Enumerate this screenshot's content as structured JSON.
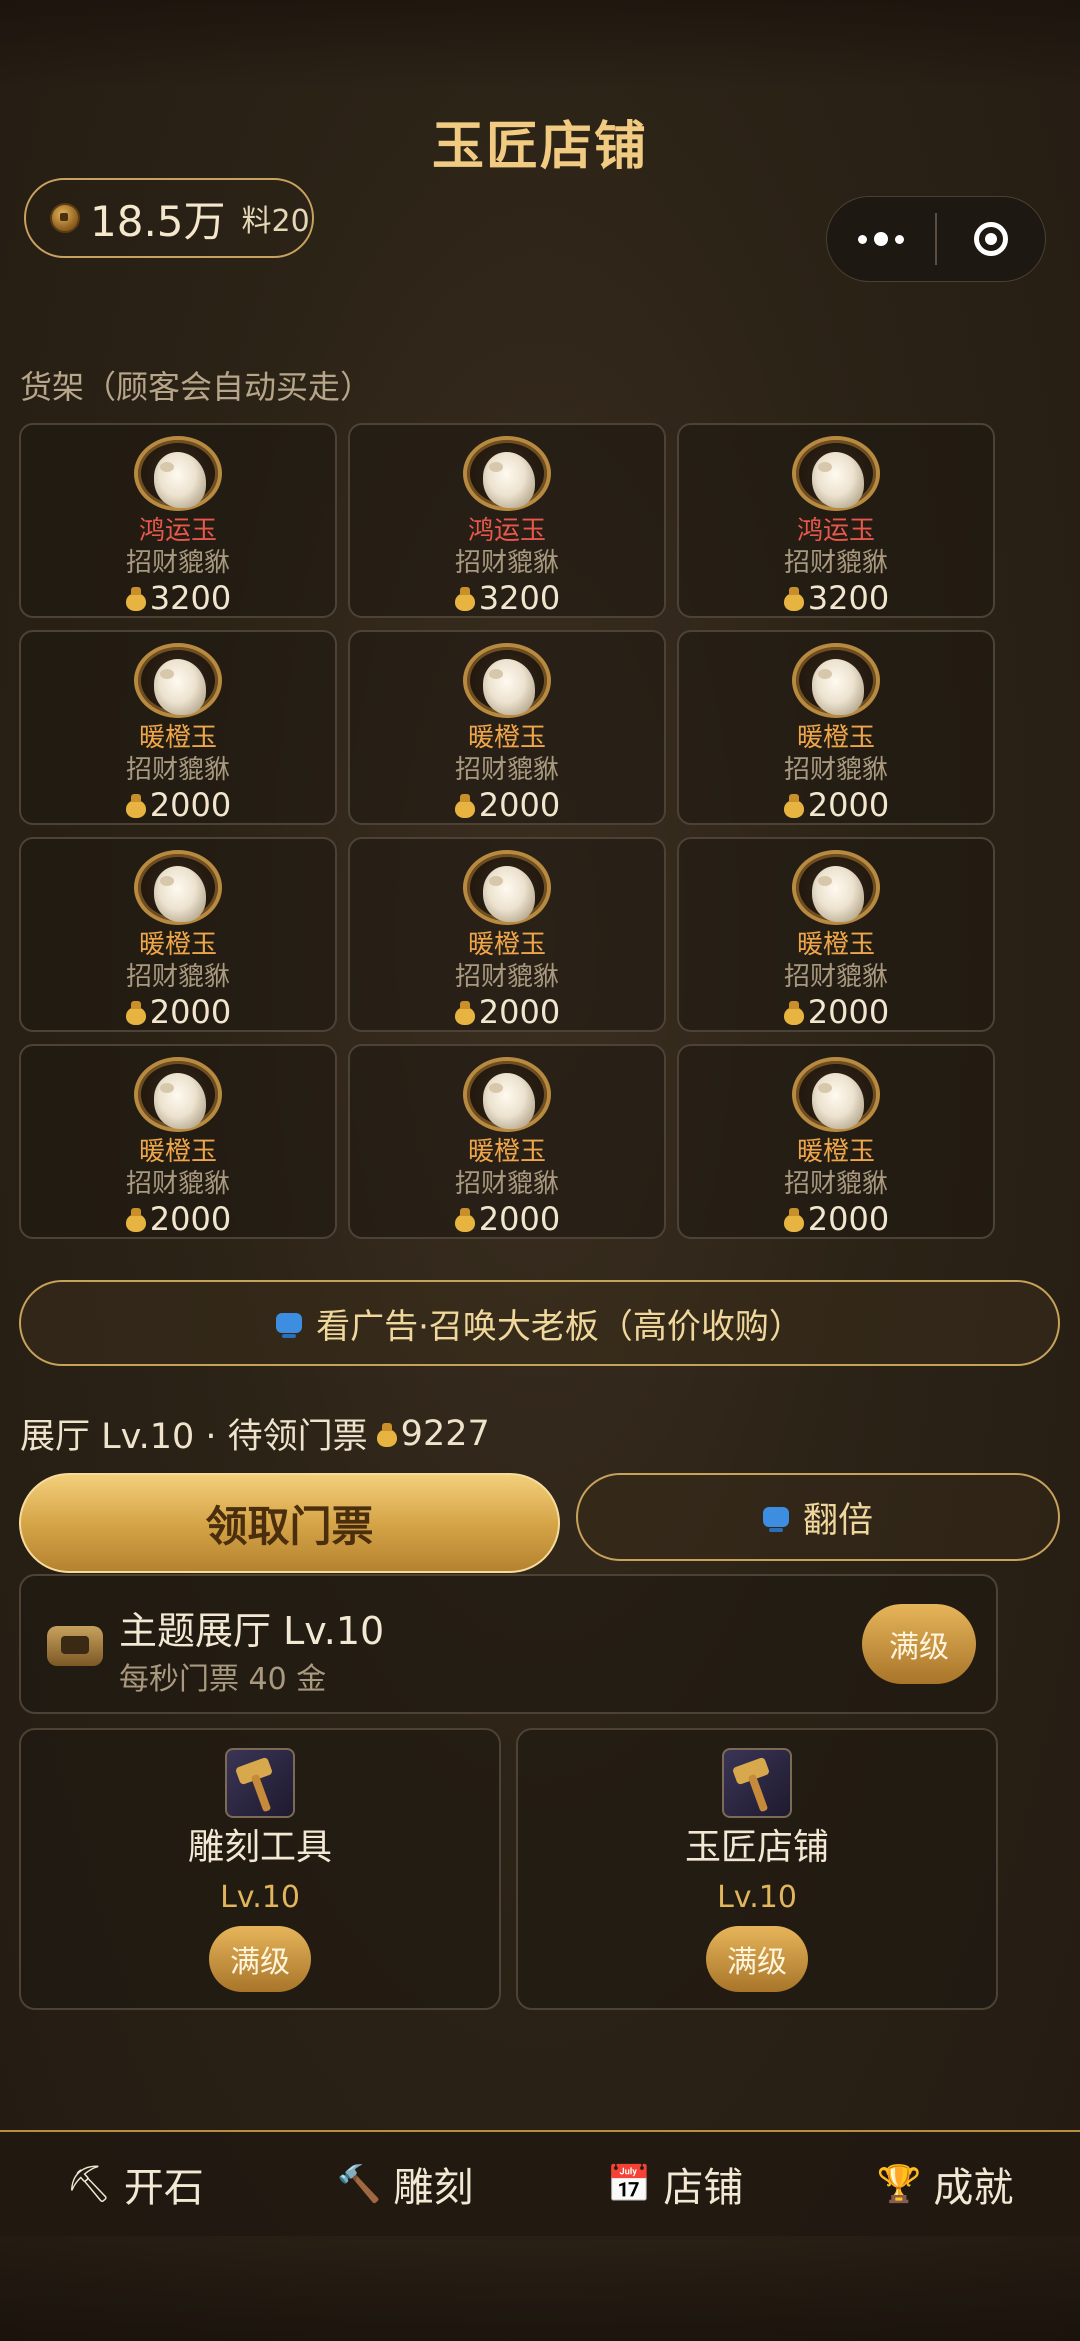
{
  "header": {
    "title": "玉匠店铺"
  },
  "wallet": {
    "amount": "18.5万",
    "material": "料20"
  },
  "shelf": {
    "label": "货架（顾客会自动买走）",
    "items": [
      {
        "grade": "鸿运玉",
        "grade_color": "red",
        "name": "招财貔貅",
        "price": "3200"
      },
      {
        "grade": "鸿运玉",
        "grade_color": "red",
        "name": "招财貔貅",
        "price": "3200"
      },
      {
        "grade": "鸿运玉",
        "grade_color": "red",
        "name": "招财貔貅",
        "price": "3200"
      },
      {
        "grade": "暖橙玉",
        "grade_color": "orange",
        "name": "招财貔貅",
        "price": "2000"
      },
      {
        "grade": "暖橙玉",
        "grade_color": "orange",
        "name": "招财貔貅",
        "price": "2000"
      },
      {
        "grade": "暖橙玉",
        "grade_color": "orange",
        "name": "招财貔貅",
        "price": "2000"
      },
      {
        "grade": "暖橙玉",
        "grade_color": "orange",
        "name": "招财貔貅",
        "price": "2000"
      },
      {
        "grade": "暖橙玉",
        "grade_color": "orange",
        "name": "招财貔貅",
        "price": "2000"
      },
      {
        "grade": "暖橙玉",
        "grade_color": "orange",
        "name": "招财貔貅",
        "price": "2000"
      },
      {
        "grade": "暖橙玉",
        "grade_color": "orange",
        "name": "招财貔貅",
        "price": "2000"
      },
      {
        "grade": "暖橙玉",
        "grade_color": "orange",
        "name": "招财貔貅",
        "price": "2000"
      },
      {
        "grade": "暖橙玉",
        "grade_color": "orange",
        "name": "招财貔貅",
        "price": "2000"
      }
    ]
  },
  "ad_button": {
    "label": "看广告·召唤大老板（高价收购）"
  },
  "hall": {
    "status": "展厅 Lv.10 · 待领门票",
    "tickets": "9227"
  },
  "actions": {
    "claim_label": "领取门票",
    "double_label": "翻倍"
  },
  "theme_hall": {
    "title": "主题展厅 Lv.10",
    "subtitle": "每秒门票 40 金",
    "max_label": "满级"
  },
  "upgrades": [
    {
      "name": "雕刻工具",
      "level": "Lv.10",
      "max_label": "满级"
    },
    {
      "name": "玉匠店铺",
      "level": "Lv.10",
      "max_label": "满级"
    }
  ],
  "tabs": [
    {
      "icon": "pickaxe-icon",
      "glyph": "⛏",
      "label": "开石"
    },
    {
      "icon": "hammer-icon",
      "glyph": "🔨",
      "label": "雕刻"
    },
    {
      "icon": "calendar-icon",
      "glyph": "📅",
      "label": "店铺"
    },
    {
      "icon": "trophy-icon",
      "glyph": "🏆",
      "label": "成就"
    }
  ]
}
